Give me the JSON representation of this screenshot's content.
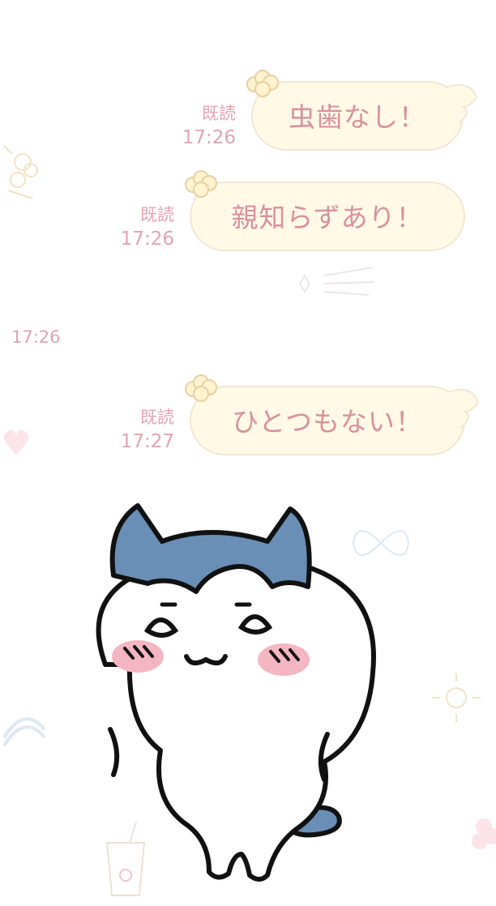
{
  "chat": {
    "messages": [
      {
        "text": "虫歯なし！",
        "read": "既読",
        "time": "17:26"
      },
      {
        "text": "親知らずあり！",
        "read": "既読",
        "time": "17:26"
      },
      {
        "text": "ひとつもない！",
        "read": "既読",
        "time": "17:27"
      }
    ],
    "sticker_time": "17:26",
    "sticker": {
      "name": "white cat character sticker"
    }
  },
  "colors": {
    "bubble_fill": "#fff9e6",
    "bubble_border": "#f1e6d4",
    "text_pink": "#d9909c",
    "meta_pink": "#e2a3b2",
    "cat_blue": "#6a8fb6",
    "blush": "#f4b6c2"
  }
}
